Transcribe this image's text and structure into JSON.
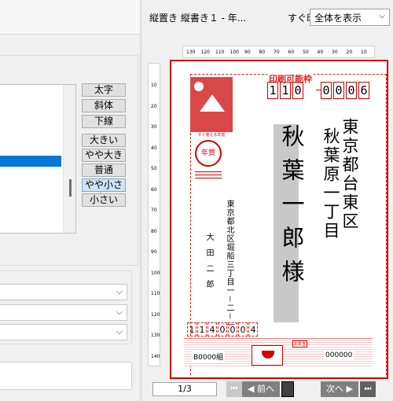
{
  "header": {
    "doc_title": "縦置き 縦書き１ - 年...",
    "quick_print": "すぐ印刷",
    "view_select": "全体を表示"
  },
  "format_buttons": {
    "bold": "太字",
    "italic": "斜体",
    "underline": "下線"
  },
  "size_buttons": [
    "大きい",
    "やや大きい",
    "普通",
    "やや小さい",
    "小さい"
  ],
  "selected_size": "やや小さい",
  "ruler": {
    "horizontal": [
      "130",
      "120",
      "110",
      "100",
      "90",
      "80",
      "70",
      "60",
      "50",
      "40",
      "30",
      "20",
      "10"
    ],
    "vertical": [
      "10",
      "20",
      "30",
      "40",
      "50",
      "60",
      "70",
      "80",
      "90",
      "100",
      "110",
      "120",
      "130",
      "140"
    ]
  },
  "card": {
    "printable_label": "印刷可能枠",
    "postal_code": [
      "1",
      "1",
      "0",
      "0",
      "0",
      "0",
      "6"
    ],
    "address_line1": "東京都台東区",
    "address_line2": "秋葉原一丁目",
    "recipient_name": "秋葉一郎様",
    "sender_address_line1": "東京都北区堀船三丁目一－二－一",
    "sender_name": "大田二郎",
    "sender_postal_code": [
      "1",
      "1",
      "4",
      "0",
      "0",
      "0",
      "4"
    ],
    "stamp_caption": "すぐ使える年賀",
    "nenga_mark": "年賀",
    "lottery_left": "B0000組",
    "lottery_right": "000000",
    "lottery_tag": "お年玉"
  },
  "nav": {
    "page": "1/3",
    "prev": "前へ",
    "next": "次へ",
    "first_icon": "first-page-icon",
    "prev_icon": "prev-icon",
    "next_icon": "next-icon",
    "last_icon": "last-page-icon"
  },
  "colors": {
    "accent_red": "#d00000",
    "selection_blue": "#0078d7"
  }
}
